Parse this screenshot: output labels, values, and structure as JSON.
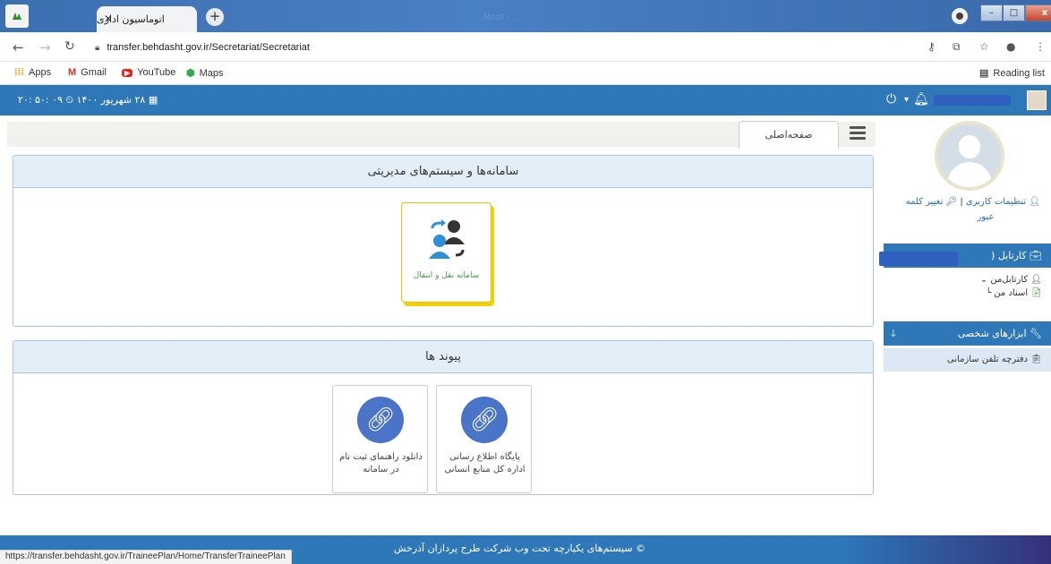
{
  "browser": {
    "tab_title": "اتوماسیون اداری",
    "tab_close": "✕",
    "new_tab": "+",
    "window_title_ghost": "Mozil - ...",
    "url": "transfer.behdasht.gov.ir/Secretariat/Secretariat",
    "bookmarks": [
      {
        "label": "Apps"
      },
      {
        "label": "Gmail"
      },
      {
        "label": "YouTube"
      },
      {
        "label": "Maps"
      }
    ],
    "reading_list": "Reading list",
    "status_url": "https://transfer.behdasht.gov.ir/TraineePlan/Home/TransferTraineePlan"
  },
  "header": {
    "datetime": "۲۸ شهریور ۱۴۰۰ ⏲ ۰۹ :۵۰ :۲۰"
  },
  "page_tab": "صفحه‌اصلی",
  "panels": {
    "systems_title": "سامانه‌ها و سیستم‌های مدیریتی",
    "transfer_card": "سامانه نقل و انتقال",
    "links_title": "پیوند ها",
    "link_cards": [
      {
        "label": "پایگاه اطلاع رسانی اداره کل منابع انسانی"
      },
      {
        "label": "دانلود راهنمای ثبت نام در سامانه"
      }
    ]
  },
  "sidebar": {
    "settings": "تنظیمات کاربری",
    "separator": "|",
    "change_password": "تغییر کلمه",
    "change_password_2": "عبور",
    "cartable_title": "کارتابل (",
    "inbox_items": [
      {
        "label": "کارتابل‌من"
      },
      {
        "label": "اسناد من"
      }
    ],
    "tools_title": "ابزارهای شخصی",
    "phonebook": "دفترچه تلفن سازمانی"
  },
  "footer": {
    "text": "© سیستم‌های یکپارچه تحت وب شرکت طرح پردازان آذرخش"
  },
  "colors": {
    "header_blue": "#2e78b8",
    "panel_head": "#e3eef8",
    "accent_yellow": "#f6cf00"
  }
}
